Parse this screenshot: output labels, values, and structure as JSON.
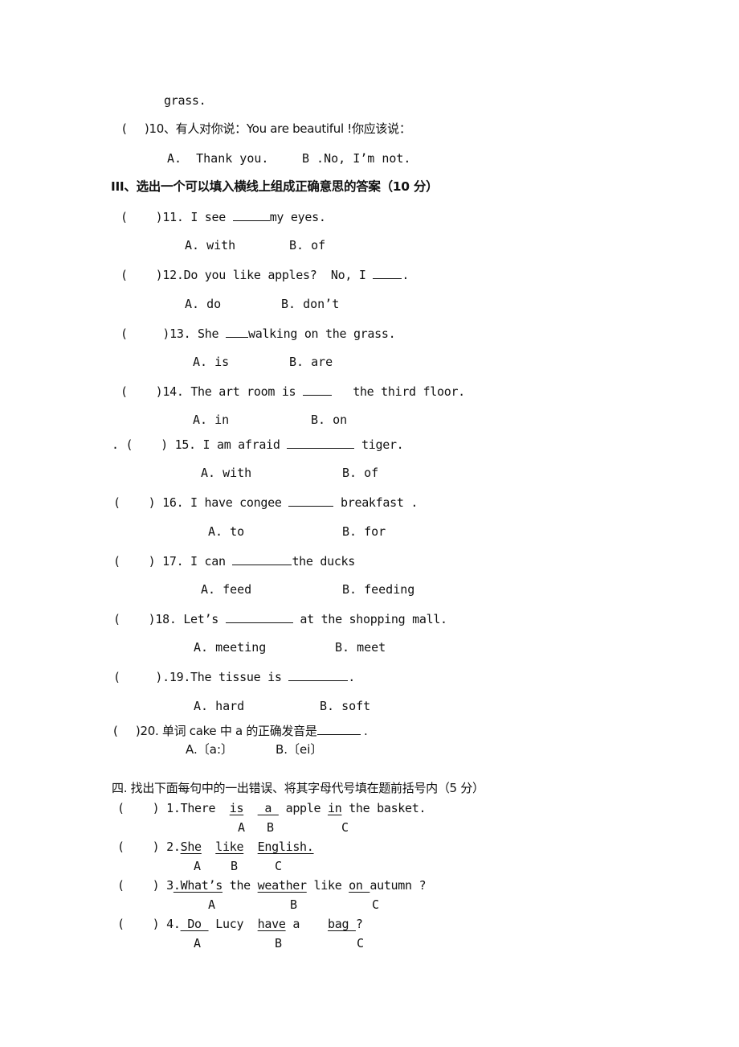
{
  "prev_tail": "grass.",
  "q10": {
    "paren": "(     )",
    "text": "10、有人对你说：You are beautiful !你应该说：",
    "a": "A.  Thank you.",
    "b": "B .No, I’m not."
  },
  "section3": {
    "title": "III、选出一个可以填入横线上组成正确意思的答案（10 分）",
    "questions": [
      {
        "paren": "(    )",
        "pre": "11. I see ",
        "post": "my eyes.",
        "a": "A. with",
        "b": "B. of"
      },
      {
        "paren": "(    )",
        "pre": "12.Do you like apples?  No, I ",
        "post": ".",
        "a": "A. do",
        "b": "B. don’t"
      },
      {
        "paren": "(     )",
        "pre": "13. She ",
        "post": "walking on the grass.",
        "a": "A. is",
        "b": "B. are"
      },
      {
        "paren": "(    )",
        "pre": "14. The art room is ",
        "post": "   the third floor.",
        "a": "A. in",
        "b": "B. on"
      },
      {
        "paren": ". (    )",
        "pre": " 15. I am afraid ",
        "post": " tiger.",
        "a": "A. with",
        "b": "B. of"
      },
      {
        "paren": "(    )",
        "pre": " 16. I have congee ",
        "post": " breakfast .",
        "a": "A. to",
        "b": "B. for"
      },
      {
        "paren": "(    )",
        "pre": " 17. I can ",
        "post": "the ducks",
        "a": "A. feed",
        "b": "B. feeding"
      },
      {
        "paren": "(    )",
        "pre": "18. Let’s ",
        "post": " at the shopping mall.",
        "a": "A. meeting",
        "b": "B. meet"
      },
      {
        "paren": "(     )",
        "pre": ".19.The tissue is ",
        "post": ".",
        "a": "A. hard",
        "b": "B. soft"
      },
      {
        "paren": "(     )",
        "pre": "20. 单词 cake 中 a 的正确发音是",
        "post": " .",
        "a": "A.〔a:〕",
        "b": "B.〔ei〕"
      }
    ]
  },
  "section4": {
    "title": "四. 找出下面每句中的一出错误、将其字母代号填在题前括号内（5 分）",
    "questions": [
      {
        "paren": "(    )",
        "num": "1.",
        "labels": [
          "A",
          "B",
          "C"
        ]
      },
      {
        "paren": "(    )",
        "num": "2.",
        "labels": [
          "A",
          "B",
          "C"
        ]
      },
      {
        "paren": "(    )",
        "num": "3.",
        "labels": [
          "A",
          "B",
          "C"
        ]
      },
      {
        "paren": "(    )",
        "num": "4.",
        "labels": [
          "A",
          "B",
          "C"
        ]
      }
    ],
    "q1": {
      "w1": "There  ",
      "u1": "is",
      "w2": "  ",
      "u2": " a ",
      "w3": " apple ",
      "u3": "in",
      "w4": " the basket."
    },
    "q2": {
      "u1": "She",
      "w1": "  ",
      "u2": "like",
      "w2": "  ",
      "u3": "English."
    },
    "q3": {
      "u1": ".What’s",
      "w1": " the ",
      "u2": "weather",
      "w2": " like ",
      "u3": "on ",
      "w3": "autumn ?"
    },
    "q4": {
      "u1": " Do ",
      "w1": " Lucy  ",
      "u2": "have",
      "w2": " a    ",
      "u3": "bag ",
      "w3": "?"
    }
  }
}
